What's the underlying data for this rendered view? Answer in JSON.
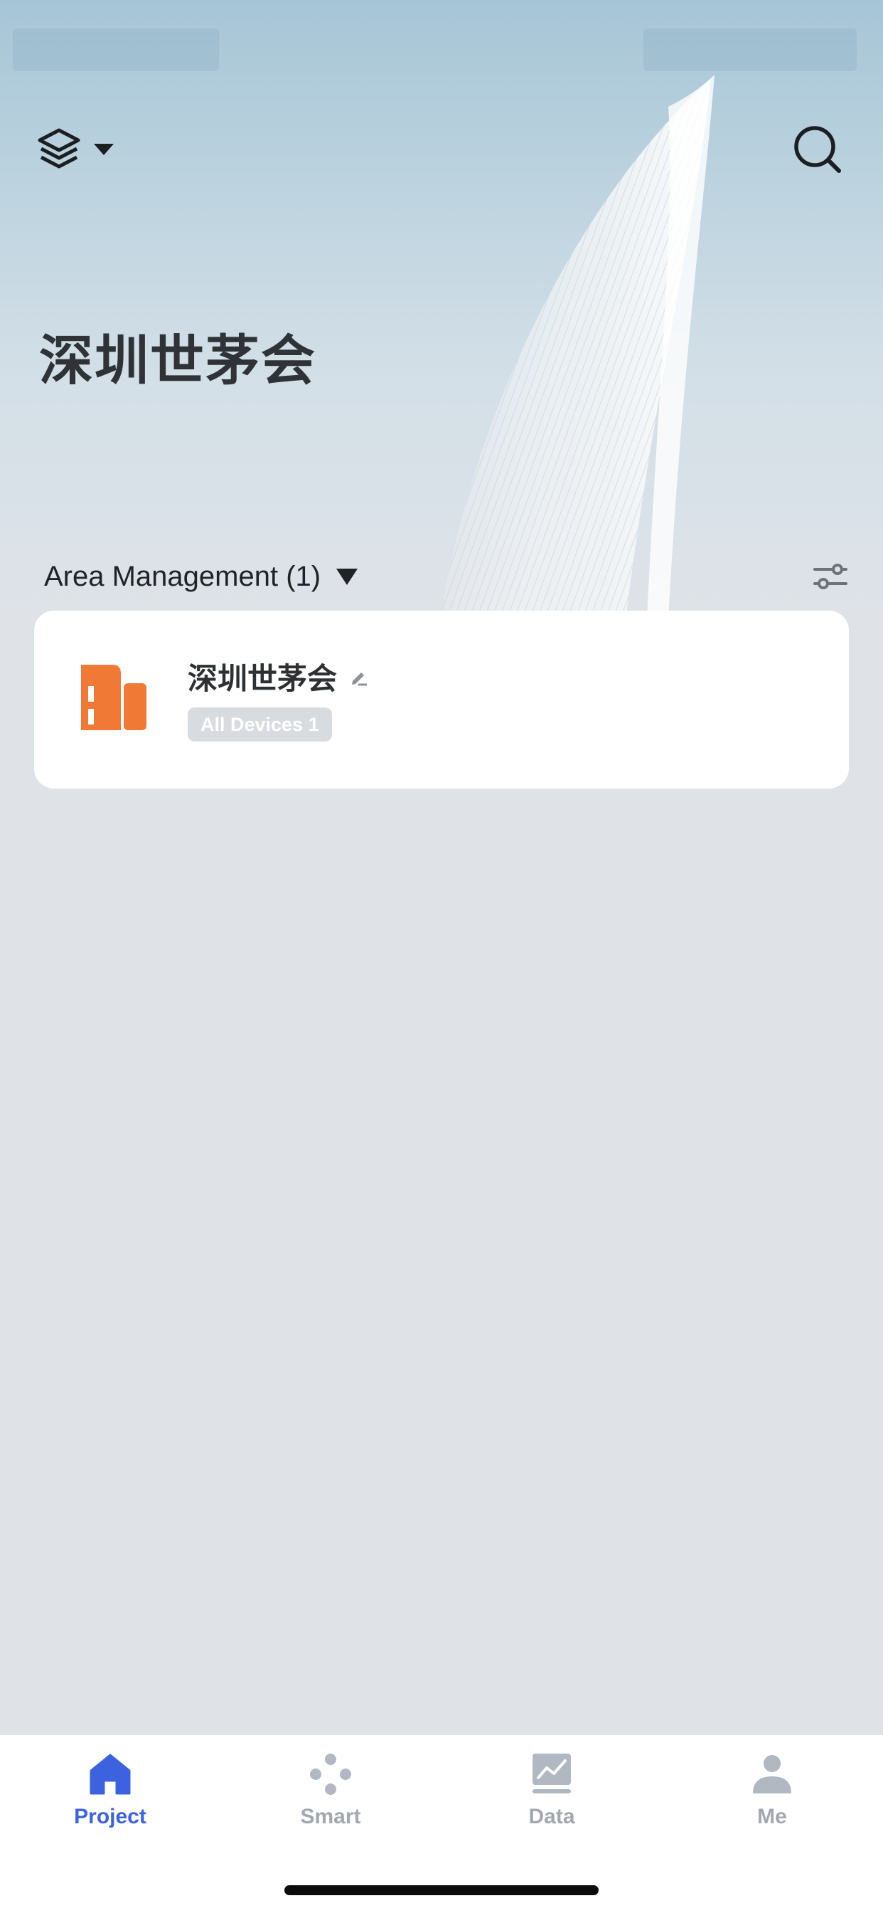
{
  "header": {
    "title": "深圳世茅会",
    "layers_icon": "layers-icon",
    "search_icon": "search-icon"
  },
  "area_section": {
    "title": "Area Management (1)",
    "dropdown_icon": "caret-down-icon",
    "filter_icon": "sliders-icon"
  },
  "areas": [
    {
      "name": "深圳世茅会",
      "badge": "All Devices 1",
      "icon": "building-icon",
      "edit_icon": "pencil-icon"
    }
  ],
  "tabbar": {
    "tabs": [
      {
        "label": "Project",
        "icon": "home-icon",
        "active": true
      },
      {
        "label": "Smart",
        "icon": "smart-dots-icon",
        "active": false
      },
      {
        "label": "Data",
        "icon": "chart-icon",
        "active": false
      },
      {
        "label": "Me",
        "icon": "person-icon",
        "active": false
      }
    ]
  },
  "colors": {
    "accent": "#3c62e0",
    "building_icon": "#f07a35",
    "inactive_tab": "#a3a8b0",
    "background": "#dfe3e8",
    "card": "#ffffff"
  }
}
